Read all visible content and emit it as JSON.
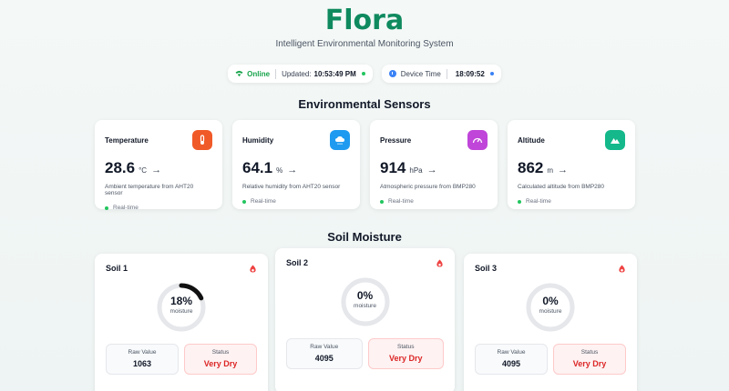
{
  "header": {
    "title": "Flora",
    "subtitle": "Intelligent Environmental Monitoring System"
  },
  "status": {
    "online_label": "Online",
    "updated_label": "Updated:",
    "updated_time": "10:53:49 PM",
    "device_label": "Device Time",
    "device_time": "18:09:52"
  },
  "sections": {
    "sensors_title": "Environmental Sensors",
    "soil_title": "Soil Moisture"
  },
  "sensors": [
    {
      "name": "Temperature",
      "value": "28.6",
      "unit": "°C",
      "desc": "Ambient temperature from AHT20 sensor",
      "status": "Real-time",
      "icon": "thermometer-icon",
      "color": "#f05a28"
    },
    {
      "name": "Humidity",
      "value": "64.1",
      "unit": "%",
      "desc": "Relative humidity from AHT20 sensor",
      "status": "Real-time",
      "icon": "cloud-icon",
      "color": "#1e9bf0"
    },
    {
      "name": "Pressure",
      "value": "914",
      "unit": "hPa",
      "desc": "Atmospheric pressure from BMP280",
      "status": "Real-time",
      "icon": "gauge-icon",
      "color": "#c045d9"
    },
    {
      "name": "Altitude",
      "value": "862",
      "unit": "m",
      "desc": "Calculated altitude from BMP280",
      "status": "Real-time",
      "icon": "mountain-icon",
      "color": "#14b88a"
    }
  ],
  "soil": [
    {
      "name": "Soil 1",
      "percent": "18%",
      "fraction": 0.18,
      "moisture_label": "moisture",
      "raw_label": "Raw Value",
      "raw": "1063",
      "status_label": "Status",
      "status": "Very Dry"
    },
    {
      "name": "Soil 2",
      "percent": "0%",
      "fraction": 0,
      "moisture_label": "moisture",
      "raw_label": "Raw Value",
      "raw": "4095",
      "status_label": "Status",
      "status": "Very Dry"
    },
    {
      "name": "Soil 3",
      "percent": "0%",
      "fraction": 0,
      "moisture_label": "moisture",
      "raw_label": "Raw Value",
      "raw": "4095",
      "status_label": "Status",
      "status": "Very Dry"
    }
  ],
  "colors": {
    "brand": "#0f8a5f",
    "online": "#16a34a",
    "dry": "#dc2626"
  }
}
